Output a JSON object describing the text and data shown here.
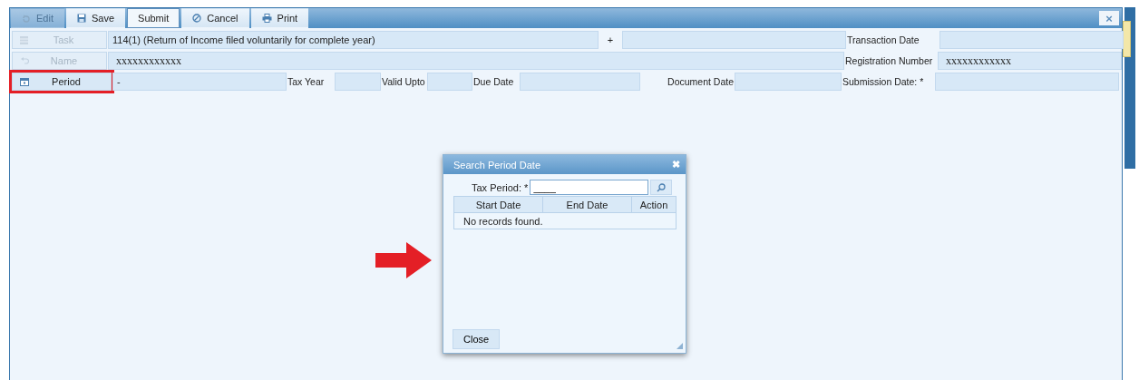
{
  "toolbar": {
    "buttons": [
      {
        "label": "Edit",
        "disabled": true,
        "focused": false
      },
      {
        "label": "Save",
        "disabled": false,
        "focused": false
      },
      {
        "label": "Submit",
        "disabled": false,
        "focused": true
      },
      {
        "label": "Cancel",
        "disabled": false,
        "focused": false
      },
      {
        "label": "Print",
        "disabled": false,
        "focused": false
      }
    ],
    "close": "×"
  },
  "form_rows": [
    {
      "items": [
        {
          "kind": "rowlabel",
          "text": "Task",
          "disabled": true,
          "highlighted": false
        },
        {
          "kind": "field",
          "value": "114(1) (Return of Income filed voluntarily for complete year)"
        },
        {
          "kind": "sign",
          "text": "+"
        },
        {
          "kind": "field",
          "value": ""
        },
        {
          "kind": "label",
          "text": "Transaction Date"
        },
        {
          "kind": "field",
          "value": ""
        }
      ]
    },
    {
      "items": [
        {
          "kind": "rowlabel",
          "text": "Name",
          "disabled": true,
          "highlighted": false
        },
        {
          "kind": "field",
          "value": "xxxxxxxxxxxx",
          "mono": true
        },
        {
          "kind": "label",
          "text": "Registration Number"
        },
        {
          "kind": "field",
          "value": "xxxxxxxxxxxx",
          "mono": true
        }
      ]
    },
    {
      "items": [
        {
          "kind": "rowlabel",
          "text": "Period",
          "disabled": false,
          "highlighted": true
        },
        {
          "kind": "field",
          "value": "-"
        },
        {
          "kind": "label",
          "text": "Tax Year"
        },
        {
          "kind": "field",
          "value": ""
        },
        {
          "kind": "label",
          "text": "Valid Upto"
        },
        {
          "kind": "field",
          "value": ""
        },
        {
          "kind": "label",
          "text": "Due Date"
        },
        {
          "kind": "field",
          "value": ""
        },
        {
          "kind": "label",
          "text": "Document Date"
        },
        {
          "kind": "field",
          "value": ""
        },
        {
          "kind": "label",
          "text": "Submission Date: *"
        },
        {
          "kind": "field",
          "value": ""
        }
      ]
    }
  ],
  "dialog": {
    "title": "Search Period Date",
    "close": "✖",
    "field_label": "Tax Period: *",
    "field_value": "____",
    "columns": [
      "Start Date",
      "End Date",
      "Action"
    ],
    "empty_message": "No records found.",
    "button": "Close"
  }
}
